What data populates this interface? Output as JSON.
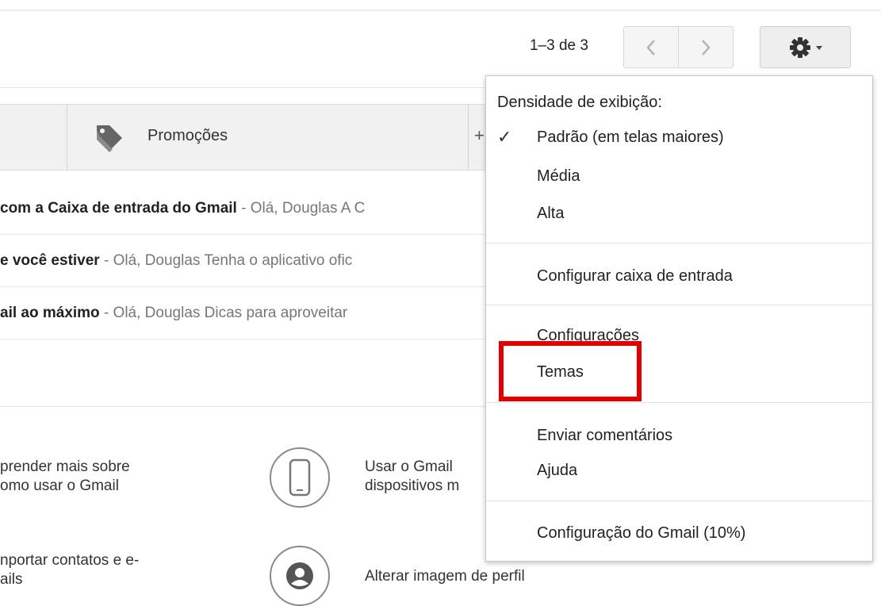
{
  "pager": {
    "range_text": "1–3 de 3",
    "prev_icon": "chevron-left-icon",
    "next_icon": "chevron-right-icon"
  },
  "settings": {
    "icon": "gear-icon"
  },
  "tabs": {
    "promocoes_label": "Promoções",
    "add_label": "+"
  },
  "emails": [
    {
      "subject": "com a Caixa de entrada do Gmail",
      "snippet": " - Olá, Douglas A C"
    },
    {
      "subject": "e você estiver",
      "snippet": " - Olá, Douglas Tenha o aplicativo ofic"
    },
    {
      "subject": "ail ao máximo",
      "snippet": " - Olá, Douglas Dicas para aproveitar"
    }
  ],
  "tips": {
    "learn": {
      "line1": "prender mais sobre",
      "line2": "omo usar o Gmail"
    },
    "import": {
      "line1": "nportar contatos e e-",
      "line2": "ails"
    },
    "devices": {
      "line1": "Usar o Gmail",
      "line2": "dispositivos m"
    },
    "profile": {
      "line1": "Alterar imagem de perfil"
    }
  },
  "menu": {
    "density_header": "Densidade de exibição:",
    "density_default": "Padrão (em telas maiores)",
    "density_medium": "Média",
    "density_high": "Alta",
    "configure_inbox": "Configurar caixa de entrada",
    "settings": "Configurações",
    "themes": "Temas",
    "send_feedback": "Enviar comentários",
    "help": "Ajuda",
    "gmail_setup": "Configuração do Gmail (10%)"
  },
  "colors": {
    "highlight": "#e00000"
  }
}
